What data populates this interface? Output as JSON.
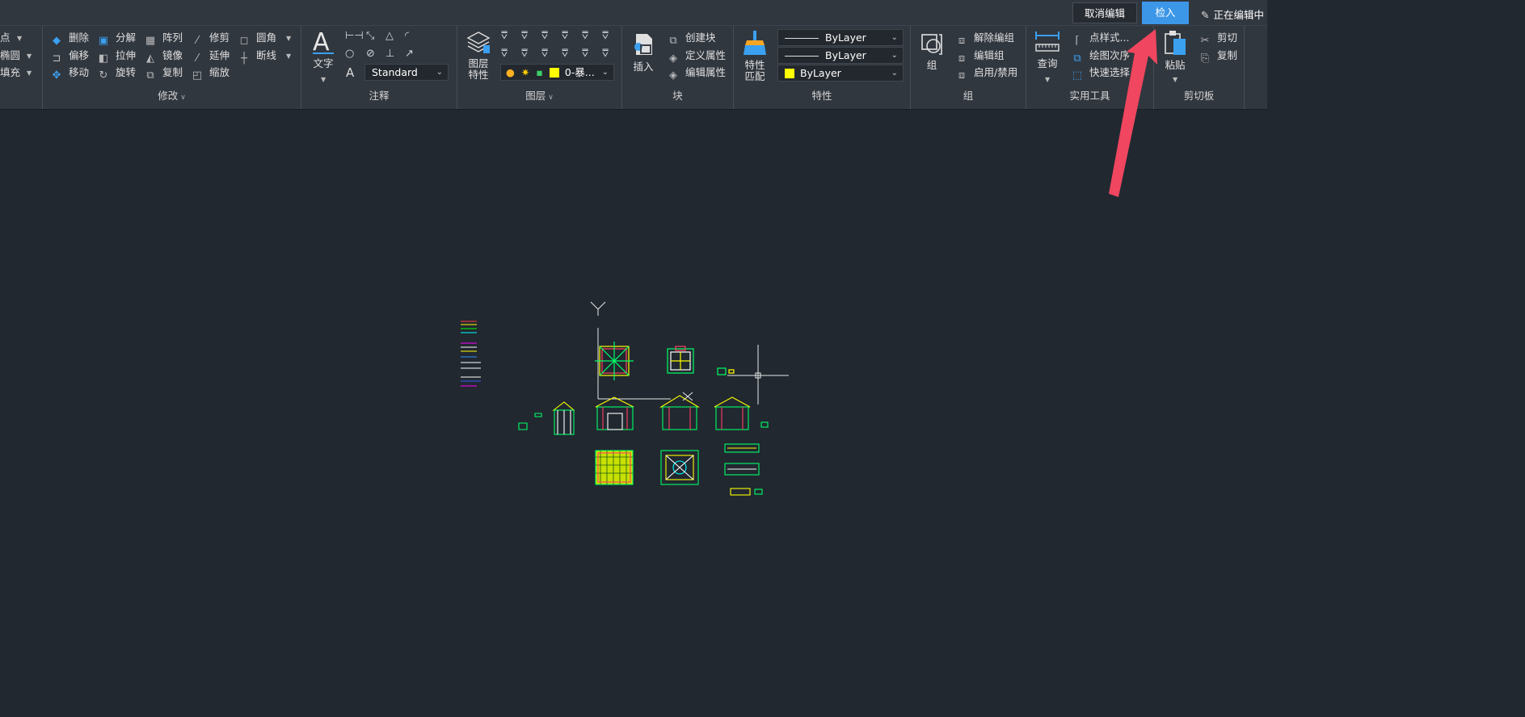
{
  "topbar": {
    "cancel_edit": "取消编辑",
    "check_in": "检入",
    "editing_status": "正在编辑中"
  },
  "ribbon": {
    "draw_partial": {
      "items": [
        "点",
        "椭圆",
        "填充"
      ]
    },
    "modify": {
      "title": "修改",
      "items": {
        "delete": "删除",
        "explode": "分解",
        "array": "阵列",
        "trim": "修剪",
        "fillet": "圆角",
        "offset": "偏移",
        "stretch": "拉伸",
        "mirror": "镜像",
        "extend": "延伸",
        "break": "断线",
        "move": "移动",
        "rotate": "旋转",
        "copy": "复制",
        "scale": "缩放"
      }
    },
    "annotation": {
      "title": "注释",
      "text_label": "文字",
      "text_style": "Standard"
    },
    "layer": {
      "title": "图层",
      "properties_line1": "图层",
      "properties_line2": "特性",
      "current_layer": "0-暴..."
    },
    "block": {
      "title": "块",
      "insert": "插入",
      "create": "创建块",
      "define_attr": "定义属性",
      "edit_attr": "编辑属性"
    },
    "properties": {
      "title": "特性",
      "match_line1": "特性",
      "match_line2": "匹配",
      "linetype": "ByLayer",
      "lineweight": "ByLayer",
      "color": "ByLayer",
      "color_hex": "#ffff00"
    },
    "group": {
      "title": "组",
      "group_label": "组",
      "ungroup": "解除编组",
      "edit_group": "编辑组",
      "enable_disable": "启用/禁用"
    },
    "utilities": {
      "title": "实用工具",
      "query": "查询",
      "point_style": "点样式...",
      "draw_order": "绘图次序",
      "quick_select": "快速选择"
    },
    "clipboard": {
      "title": "剪切板",
      "paste": "粘贴",
      "cut": "剪切",
      "copy": "复制"
    }
  },
  "colors": {
    "accent": "#3d97e8",
    "canvas_bg": "#212830",
    "ribbon_bg": "#31373f",
    "annotation_arrow": "#f0465f"
  }
}
